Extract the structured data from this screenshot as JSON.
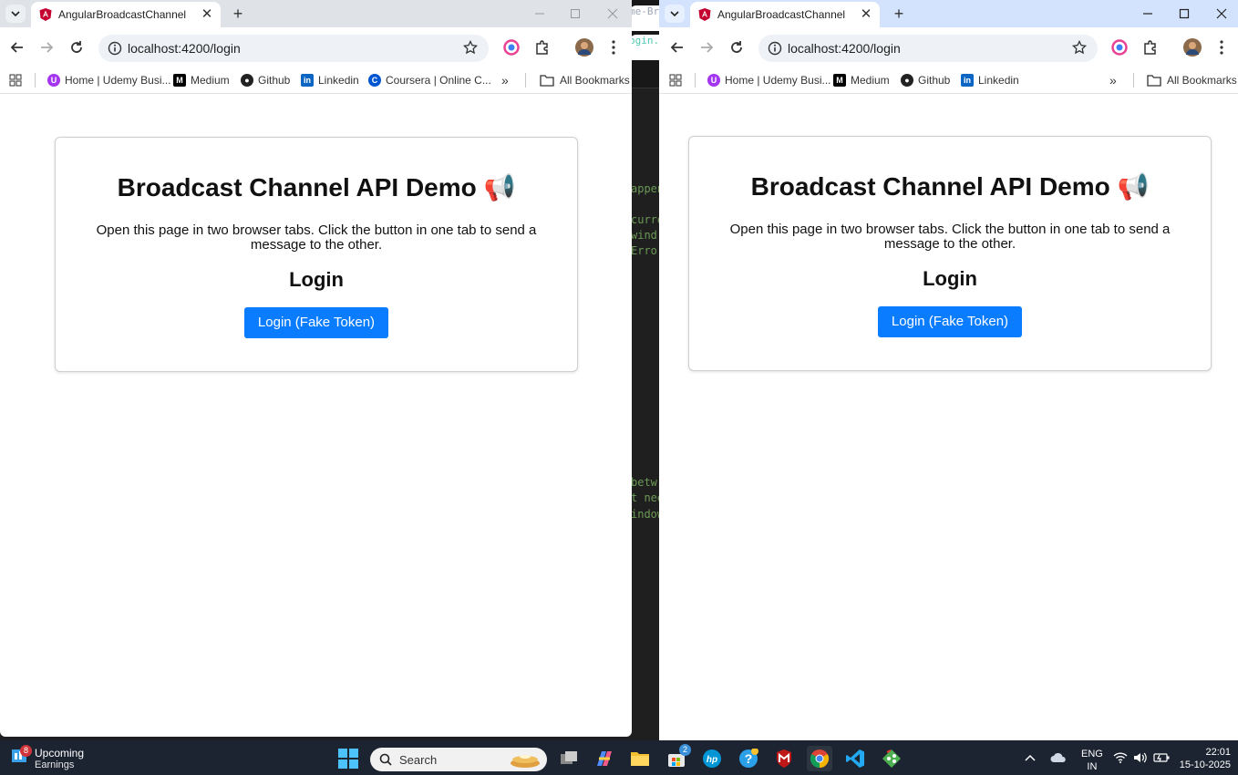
{
  "editor": {
    "top_lines": [
      "me-Br",
      "ogin.c"
    ],
    "code_lines": [
      "appen",
      "curre",
      " wind",
      "Error",
      "betw",
      "t nee",
      "indow"
    ]
  },
  "left_window": {
    "tab_title": "AngularBroadcastChannel",
    "url": "localhost:4200/login",
    "bookmarks": [
      "Home | Udemy Busi...",
      "Medium",
      "Github",
      "Linkedin",
      "Coursera | Online C..."
    ],
    "all_bookmarks": "All Bookmarks",
    "heading": "Broadcast Channel API Demo 📢",
    "description": "Open this page in two browser tabs. Click the button in one tab to send a message to the other.",
    "subheading": "Login",
    "button": "Login (Fake Token)"
  },
  "right_window": {
    "tab_title": "AngularBroadcastChannel",
    "url": "localhost:4200/login",
    "bookmarks": [
      "Home | Udemy Busi...",
      "Medium",
      "Github",
      "Linkedin"
    ],
    "all_bookmarks": "All Bookmarks",
    "heading": "Broadcast Channel API Demo 📢",
    "description": "Open this page in two browser tabs. Click the button in one tab to send a message to the other.",
    "subheading": "Login",
    "button": "Login (Fake Token)"
  },
  "taskbar": {
    "weather_badge": "8",
    "weather_line1": "Upcoming",
    "weather_line2": "Earnings",
    "search_label": "Search",
    "store_badge": "2",
    "lang_line1": "ENG",
    "lang_line2": "IN",
    "time": "22:01",
    "date": "15-10-2025"
  },
  "colors": {
    "accent_button": "#0a7cff",
    "left_tabbar": "#dfe3e8",
    "right_tabbar": "#d3e3fd",
    "taskbar": "#1c2431"
  }
}
